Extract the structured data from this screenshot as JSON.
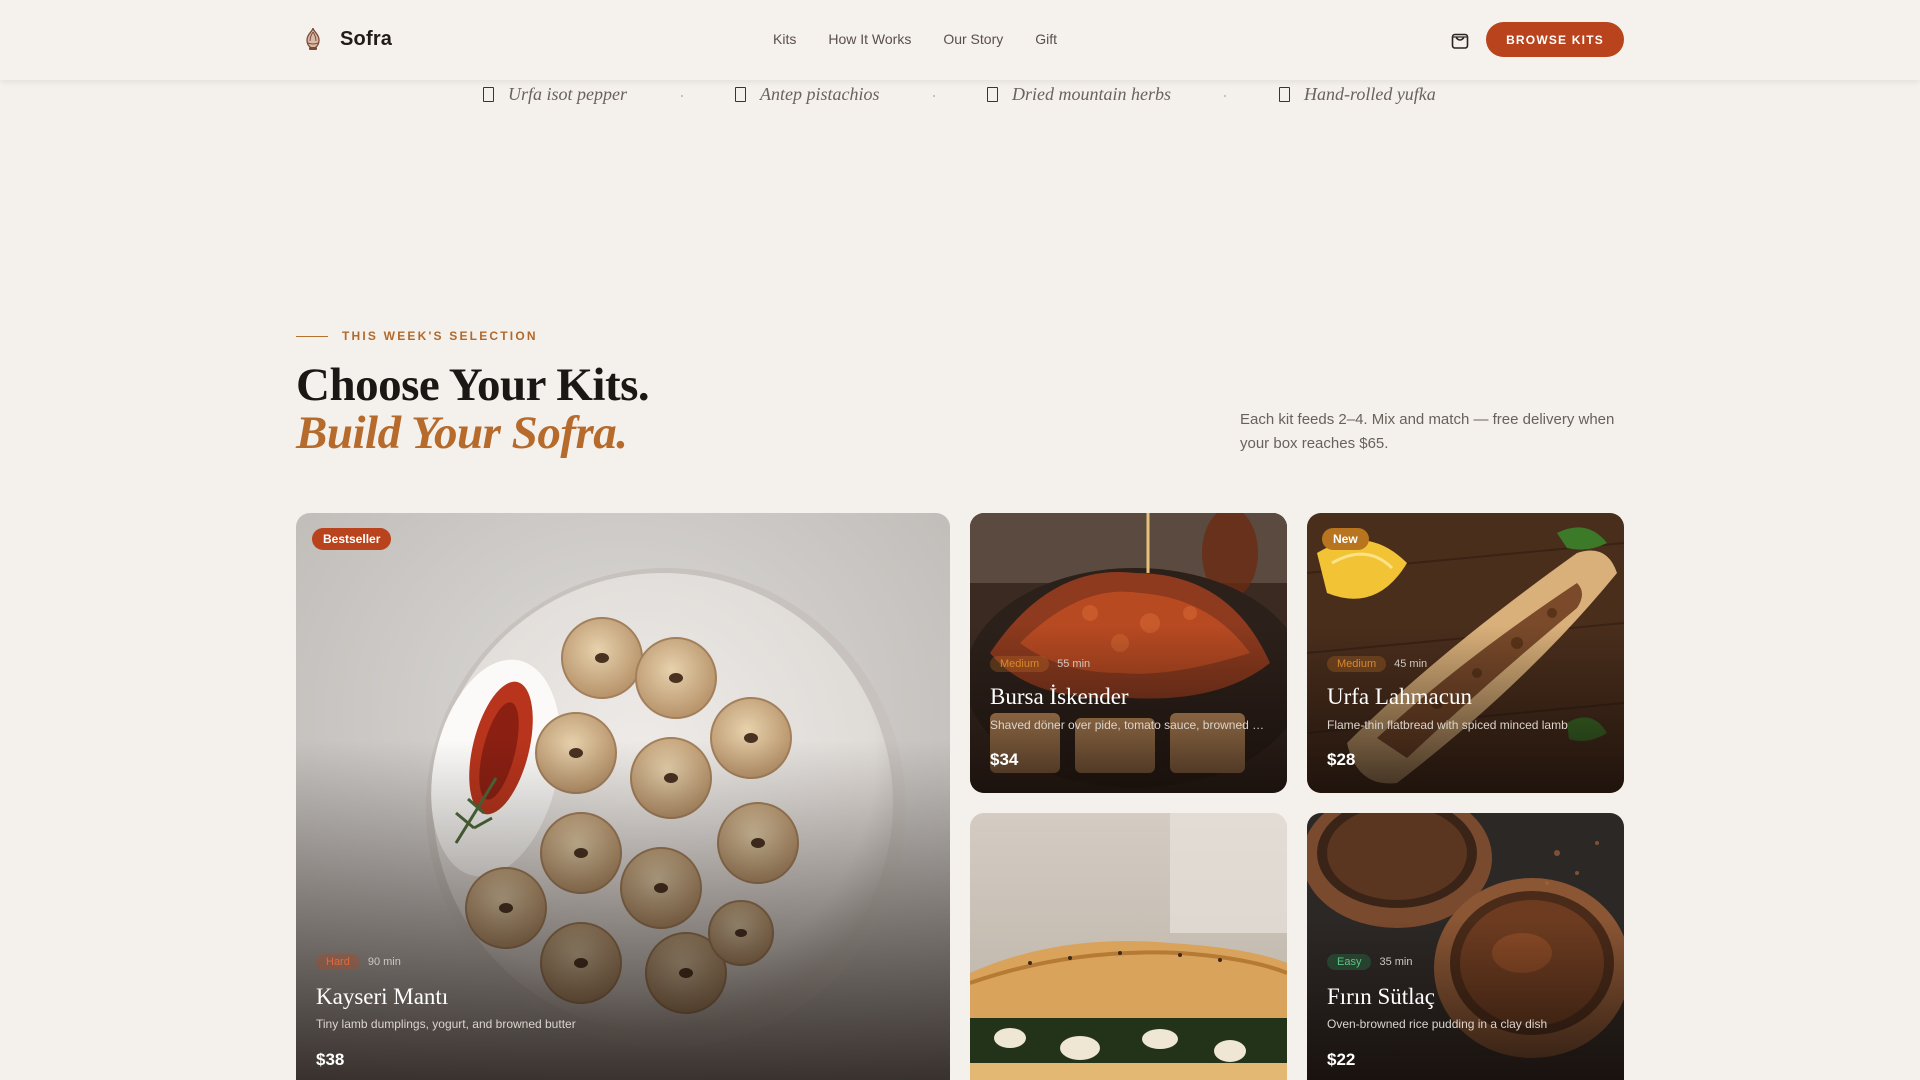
{
  "brand": {
    "name": "Sofra",
    "logo_icon": "onion-dome-icon"
  },
  "nav": {
    "items": [
      "Kits",
      "How It Works",
      "Our Story",
      "Gift"
    ]
  },
  "header": {
    "cart_icon": "shopping-bag-icon",
    "cta_label": "BROWSE KITS"
  },
  "ingredients": [
    "Urfa isot pepper",
    "Antep pistachios",
    "Dried mountain herbs",
    "Hand-rolled yufka"
  ],
  "section": {
    "eyebrow": "THIS WEEK'S SELECTION",
    "title_line1": "Choose Your Kits.",
    "title_line2": "Build Your Sofra.",
    "intro": "Each kit feeds 2–4. Mix and match — free delivery when your box reaches $65."
  },
  "kits": [
    {
      "badge": "Bestseller",
      "difficulty": "Hard",
      "time": "90 min",
      "name": "Kayseri Mantı",
      "description": "Tiny lamb dumplings, yogurt, and browned butter",
      "price": "$38"
    },
    {
      "badge": "",
      "difficulty": "Medium",
      "time": "55 min",
      "name": "Bursa İskender",
      "description": "Shaved döner over pide, tomato sauce, browned butter",
      "price": "$34"
    },
    {
      "badge": "New",
      "difficulty": "Medium",
      "time": "45 min",
      "name": "Urfa Lahmacun",
      "description": "Flame-thin flatbread with spiced minced lamb",
      "price": "$28"
    },
    {
      "badge": "",
      "difficulty": "",
      "time": "",
      "name": "",
      "description": "",
      "price": ""
    },
    {
      "badge": "",
      "difficulty": "Easy",
      "time": "35 min",
      "name": "Fırın Sütlaç",
      "description": "Oven-browned rice pudding in a clay dish",
      "price": "$22"
    }
  ],
  "colors": {
    "accent": "#b9431c",
    "gold": "#b66a2b",
    "background": "#f4f0ec"
  }
}
